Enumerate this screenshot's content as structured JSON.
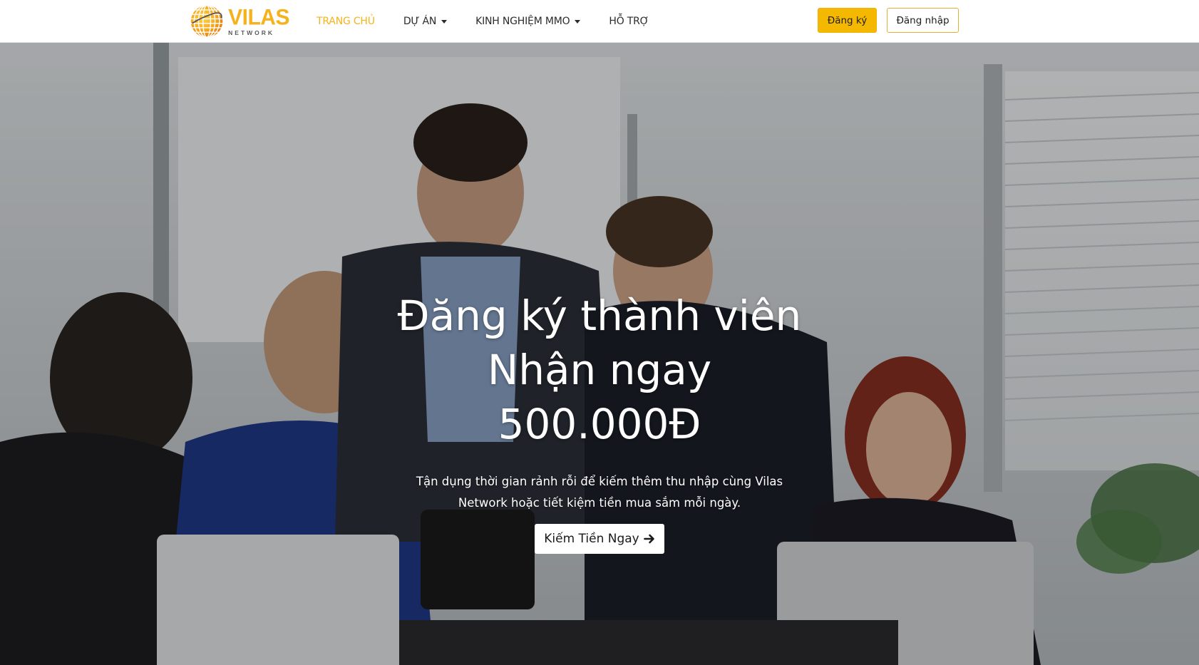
{
  "brand": {
    "name": "VILAS",
    "tagline": "NETWORK",
    "colors": {
      "accent": "#f5b21c",
      "button_yellow": "#f5b800"
    }
  },
  "nav": {
    "items": [
      {
        "label": "TRANG CHỦ",
        "active": true,
        "has_dropdown": false
      },
      {
        "label": "DỰ ÁN",
        "active": false,
        "has_dropdown": true
      },
      {
        "label": "KINH NGHIỆM MMO",
        "active": false,
        "has_dropdown": true
      },
      {
        "label": "HỖ TRỢ",
        "active": false,
        "has_dropdown": false
      }
    ],
    "register_label": "Đăng ký",
    "login_label": "Đăng nhập"
  },
  "hero": {
    "title_line1": "Đăng ký thành viên",
    "title_line2": "Nhận ngay",
    "title_line3": "500.000Đ",
    "subtitle": "Tận dụng thời gian rảnh rỗi để kiếm thêm thu nhập cùng Vilas Network hoặc tiết kiệm tiền mua sắm mỗi ngày.",
    "cta_label": "Kiếm Tiền Ngay",
    "cta_icon": "arrow-right-icon"
  }
}
